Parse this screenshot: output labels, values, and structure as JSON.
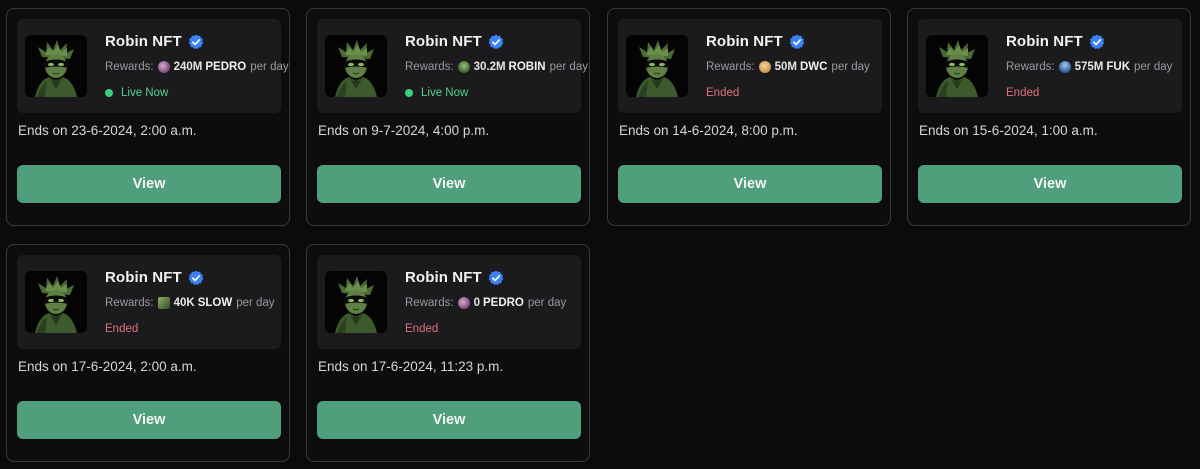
{
  "colors": {
    "button_bg": "#4f9e7c",
    "live": "#4fd28a",
    "ended": "#e0707a",
    "verified": "#3b82f6"
  },
  "cards": [
    {
      "name": "Robin NFT",
      "rewards_label": "Rewards:",
      "token_icon": "pedro-token-icon",
      "amount": "240M",
      "token": "PEDRO",
      "per": "per day",
      "status": "Live Now",
      "ends": "Ends on 23-6-2024, 2:00 a.m.",
      "button": "View"
    },
    {
      "name": "Robin NFT",
      "rewards_label": "Rewards:",
      "token_icon": "robin-token-icon",
      "amount": "30.2M",
      "token": "ROBIN",
      "per": "per day",
      "status": "Live Now",
      "ends": "Ends on 9-7-2024, 4:00 p.m.",
      "button": "View"
    },
    {
      "name": "Robin NFT",
      "rewards_label": "Rewards:",
      "token_icon": "dwc-token-icon",
      "amount": "50M",
      "token": "DWC",
      "per": "per day",
      "status": "Ended",
      "ends": "Ends on 14-6-2024, 8:00 p.m.",
      "button": "View"
    },
    {
      "name": "Robin NFT",
      "rewards_label": "Rewards:",
      "token_icon": "fuk-token-icon",
      "amount": "575M",
      "token": "FUK",
      "per": "per day",
      "status": "Ended",
      "ends": "Ends on 15-6-2024, 1:00 a.m.",
      "button": "View"
    },
    {
      "name": "Robin NFT",
      "rewards_label": "Rewards:",
      "token_icon": "slow-token-icon",
      "amount": "40K",
      "token": "SLOW",
      "per": "per day",
      "status": "Ended",
      "ends": "Ends on 17-6-2024, 2:00 a.m.",
      "button": "View"
    },
    {
      "name": "Robin NFT",
      "rewards_label": "Rewards:",
      "token_icon": "pedro-token-icon",
      "amount": "0",
      "token": "PEDRO",
      "per": "per day",
      "status": "Ended",
      "ends": "Ends on 17-6-2024, 11:23 p.m.",
      "button": "View"
    }
  ]
}
